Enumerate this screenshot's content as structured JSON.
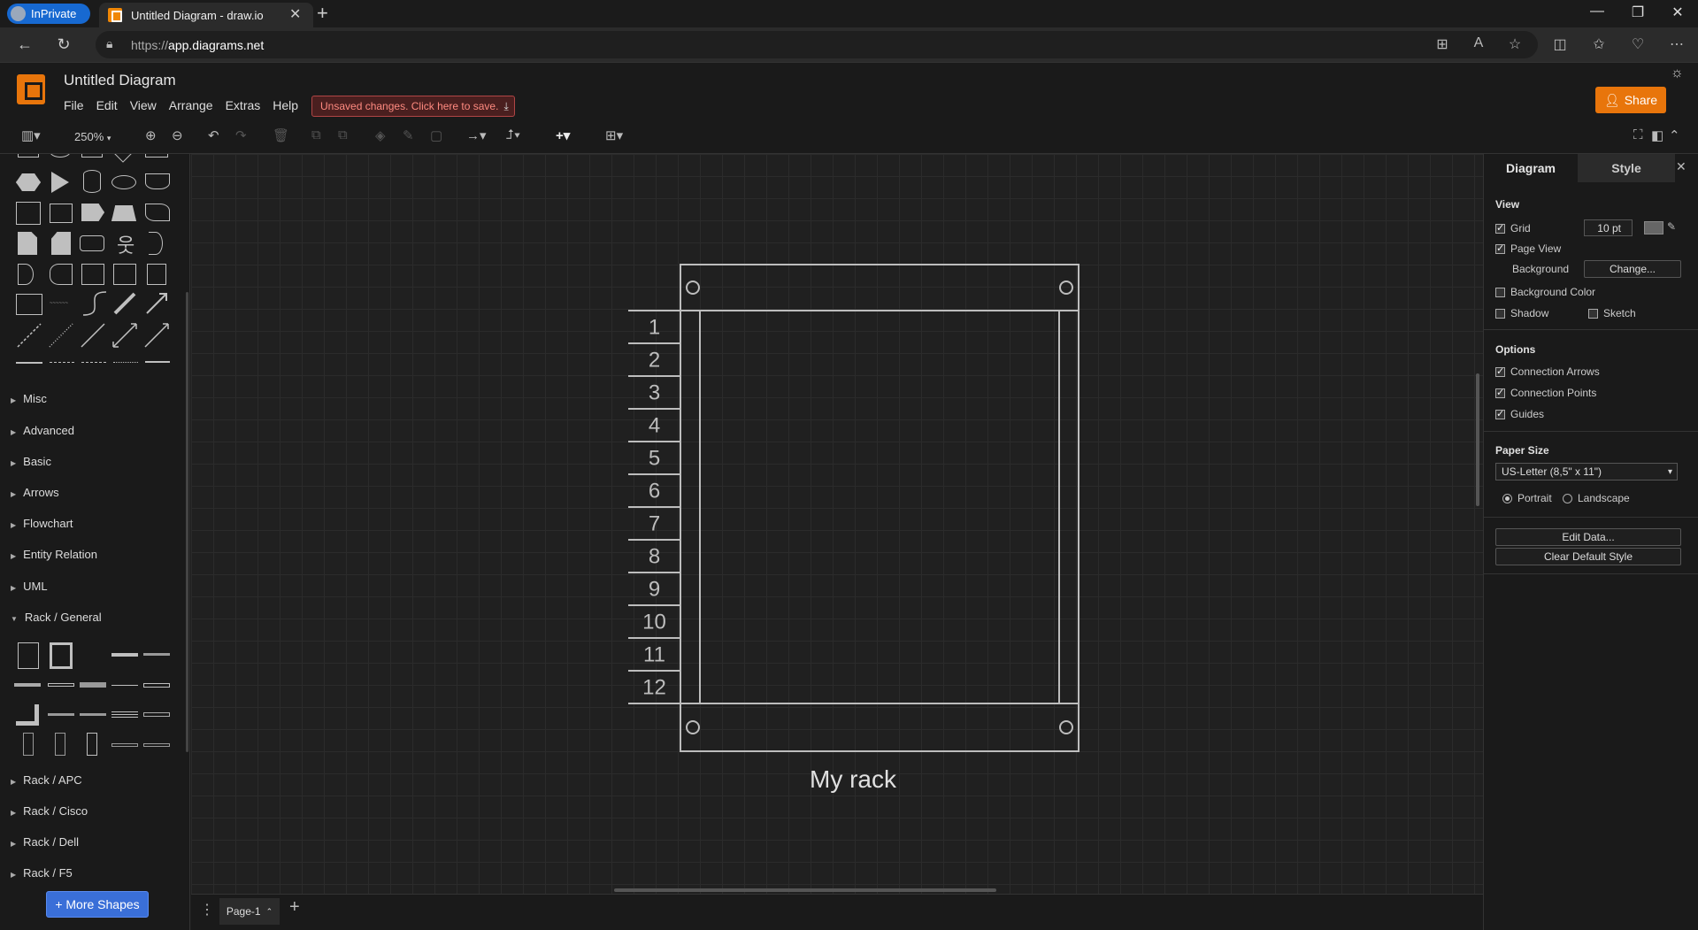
{
  "browser": {
    "inprivate_label": "InPrivate",
    "tab_title": "Untitled Diagram - draw.io",
    "url_protocol": "https://",
    "url_host": "app.diagrams.net"
  },
  "app": {
    "title": "Untitled Diagram",
    "menu": [
      "File",
      "Edit",
      "View",
      "Arrange",
      "Extras",
      "Help"
    ],
    "unsaved_notice": "Unsaved changes. Click here to save.",
    "share_label": "Share",
    "zoom": "250%"
  },
  "left_panel": {
    "sections": [
      {
        "label": "Misc",
        "expanded": false
      },
      {
        "label": "Advanced",
        "expanded": false
      },
      {
        "label": "Basic",
        "expanded": false
      },
      {
        "label": "Arrows",
        "expanded": false
      },
      {
        "label": "Flowchart",
        "expanded": false
      },
      {
        "label": "Entity Relation",
        "expanded": false
      },
      {
        "label": "UML",
        "expanded": false
      },
      {
        "label": "Rack / General",
        "expanded": true
      },
      {
        "label": "Rack / APC",
        "expanded": false
      },
      {
        "label": "Rack / Cisco",
        "expanded": false
      },
      {
        "label": "Rack / Dell",
        "expanded": false
      },
      {
        "label": "Rack / F5",
        "expanded": false
      }
    ],
    "more_shapes_label": "+ More Shapes"
  },
  "canvas": {
    "rack_units": [
      "1",
      "2",
      "3",
      "4",
      "5",
      "6",
      "7",
      "8",
      "9",
      "10",
      "11",
      "12"
    ],
    "rack_label": "My rack"
  },
  "bottom": {
    "page_tab": "Page-1"
  },
  "right_panel": {
    "tabs": [
      "Diagram",
      "Style"
    ],
    "view_heading": "View",
    "grid_label": "Grid",
    "grid_checked": true,
    "grid_size": "10 pt",
    "page_view_label": "Page View",
    "page_view_checked": true,
    "background_label": "Background",
    "change_button": "Change...",
    "background_color_label": "Background Color",
    "background_color_checked": false,
    "shadow_label": "Shadow",
    "shadow_checked": false,
    "sketch_label": "Sketch",
    "sketch_checked": false,
    "options_heading": "Options",
    "connection_arrows_label": "Connection Arrows",
    "connection_arrows_checked": true,
    "connection_points_label": "Connection Points",
    "connection_points_checked": true,
    "guides_label": "Guides",
    "guides_checked": true,
    "paper_size_heading": "Paper Size",
    "paper_size_value": "US-Letter (8,5\" x 11\")",
    "portrait_label": "Portrait",
    "landscape_label": "Landscape",
    "orientation": "Portrait",
    "edit_data_button": "Edit Data...",
    "clear_default_style_button": "Clear Default Style"
  }
}
